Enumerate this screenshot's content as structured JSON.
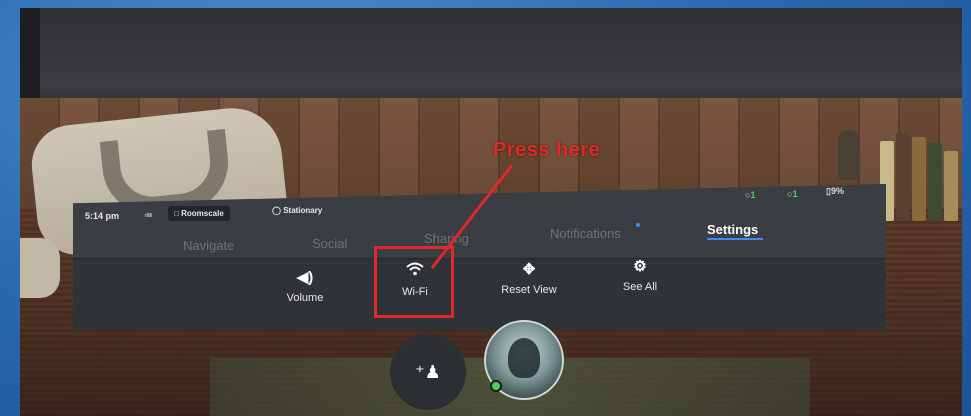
{
  "status": {
    "time": "5:14 pm",
    "mode_roomscale": "Roomscale",
    "mode_stationary": "Stationary",
    "right_indicator_1": "1",
    "right_indicator_2": "1",
    "battery": "9%"
  },
  "tabs": [
    {
      "label": "Navigate"
    },
    {
      "label": "Social"
    },
    {
      "label": "Sharing"
    },
    {
      "label": "Notifications"
    },
    {
      "label": "Settings"
    }
  ],
  "active_tab": "Settings",
  "quick_settings": [
    {
      "label": "Volume",
      "icon": "volume-icon"
    },
    {
      "label": "Wi-Fi",
      "icon": "wifi-icon"
    },
    {
      "label": "Reset View",
      "icon": "move-icon"
    },
    {
      "label": "See All",
      "icon": "gear-icon"
    }
  ],
  "annotation": {
    "text": "Press here",
    "color": "#e02a2a"
  },
  "colors": {
    "panel": "#2f3236",
    "accent": "#3d8bff",
    "online": "#46d25a"
  }
}
